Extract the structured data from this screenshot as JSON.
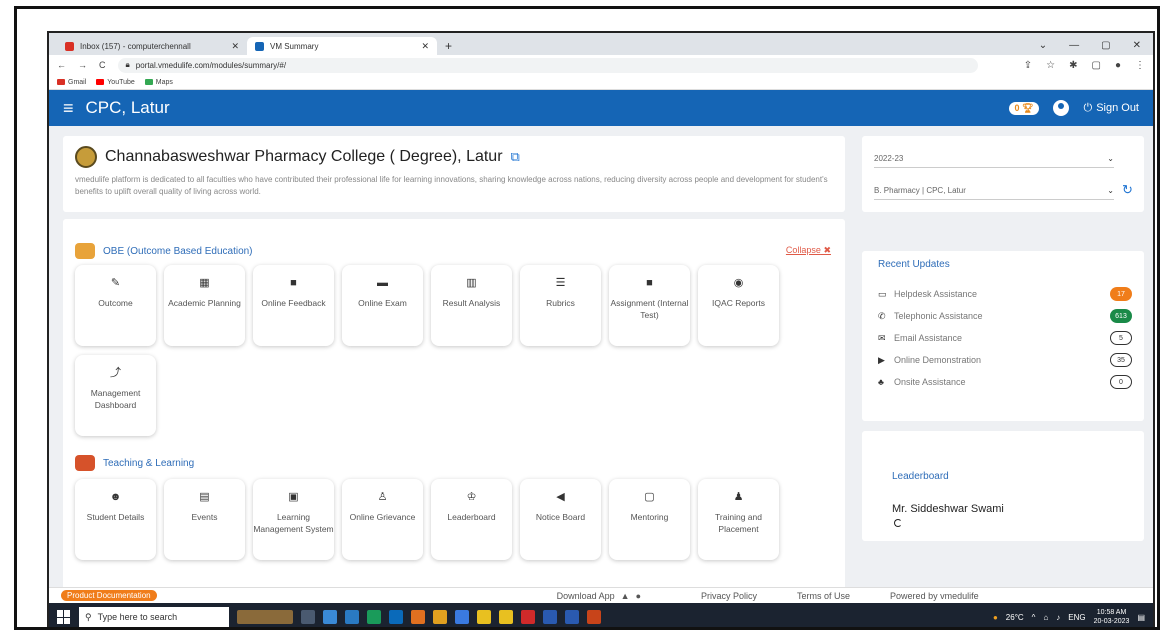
{
  "browser": {
    "tabs": [
      {
        "label": "Inbox (157) - computerchennall",
        "active": false
      },
      {
        "label": "VM Summary",
        "active": true
      }
    ],
    "url": "portal.vmedulife.com/modules/summary/#/",
    "bookmarks": [
      "Gmail",
      "YouTube",
      "Maps"
    ]
  },
  "header": {
    "title": "CPC, Latur",
    "trophy_count": "0",
    "signout_label": "Sign Out"
  },
  "college": {
    "name": "Channabasweshwar Pharmacy College ( Degree), Latur",
    "description": "vmedulife platform is dedicated to all faculties who have contributed their professional life for learning innovations, sharing knowledge across nations, reducing diversity across people and development for student's benefits to uplift overall quality of living across world."
  },
  "obe": {
    "title": "OBE (Outcome Based Education)",
    "collapse_label": "Collapse",
    "tiles": [
      {
        "icon": "✎",
        "label": "Outcome"
      },
      {
        "icon": "▦",
        "label": "Academic Planning"
      },
      {
        "icon": "■",
        "label": "Online Feedback"
      },
      {
        "icon": "▬",
        "label": "Online Exam"
      },
      {
        "icon": "▥",
        "label": "Result Analysis"
      },
      {
        "icon": "☰",
        "label": "Rubrics"
      },
      {
        "icon": "■",
        "label": "Assignment (Internal Test)"
      },
      {
        "icon": "◉",
        "label": "IQAC Reports"
      },
      {
        "icon": "⤴",
        "label": "Management Dashboard"
      }
    ]
  },
  "teaching": {
    "title": "Teaching & Learning",
    "tiles": [
      {
        "icon": "☻",
        "label": "Student Details"
      },
      {
        "icon": "▤",
        "label": "Events"
      },
      {
        "icon": "▣",
        "label": "Learning Management System"
      },
      {
        "icon": "♙",
        "label": "Online Grievance"
      },
      {
        "icon": "♔",
        "label": "Leaderboard"
      },
      {
        "icon": "◀",
        "label": "Notice Board"
      },
      {
        "icon": "▢",
        "label": "Mentoring"
      },
      {
        "icon": "♟",
        "label": "Training and Placement"
      }
    ]
  },
  "filters": {
    "year": "2022-23",
    "program": "B. Pharmacy | CPC, Latur"
  },
  "updates": {
    "title": "Recent Updates",
    "items": [
      {
        "icon": "▭",
        "label": "Helpdesk Assistance",
        "count": "17",
        "style": "orange"
      },
      {
        "icon": "✆",
        "label": "Telephonic Assistance",
        "count": "613",
        "style": "green"
      },
      {
        "icon": "✉",
        "label": "Email Assistance",
        "count": "5",
        "style": "outline"
      },
      {
        "icon": "▶",
        "label": "Online Demonstration",
        "count": "35",
        "style": "outline"
      },
      {
        "icon": "♣",
        "label": "Onsite Assistance",
        "count": "0",
        "style": "outline"
      }
    ]
  },
  "leaderboard": {
    "title": "Leaderboard",
    "name": "Mr. Siddeshwar Swami"
  },
  "footer": {
    "product_doc": "Product Documentation",
    "download_app": "Download App",
    "privacy": "Privacy Policy",
    "terms": "Terms of Use",
    "powered": "Powered by vmedulife"
  },
  "taskbar": {
    "search_placeholder": "Type here to search",
    "weather": "26°C",
    "lang": "ENG",
    "time": "10:58 AM",
    "date": "20-03-2023"
  },
  "colors": {
    "brand": "#1565b5",
    "accent_orange": "#f07d1a",
    "accent_green": "#1a8a48",
    "link_blue": "#2f6db8"
  }
}
